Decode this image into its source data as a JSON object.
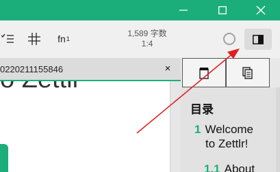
{
  "window": {
    "minimize_icon": "minimize-icon",
    "maximize_icon": "maximize-icon",
    "close_icon": "close-icon"
  },
  "toolbar": {
    "fn_label": "fn",
    "fn_sup": "1",
    "word_count": "1,589 字数",
    "ratio": "1:4"
  },
  "tab": {
    "label": "0220211155846",
    "close_label": "×"
  },
  "editor": {
    "heading_fragment": "o Zettlr"
  },
  "sidebar": {
    "toc_title": "目录",
    "toc": [
      {
        "num": "1",
        "line1": "Welcome",
        "line2": "to Zettlr!"
      },
      {
        "num": "1.1",
        "line1": "About"
      }
    ]
  },
  "colors": {
    "accent": "#1cae7a",
    "arrow": "#e02020"
  }
}
